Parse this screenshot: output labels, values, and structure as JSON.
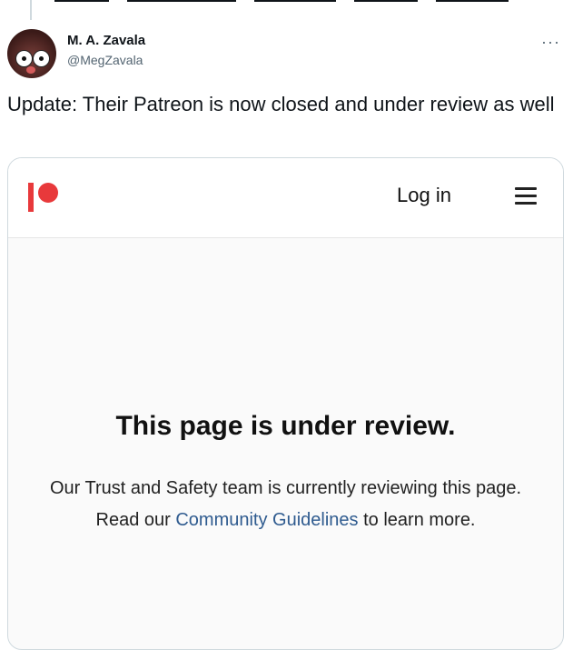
{
  "tweet": {
    "author_name": "M. A. Zavala",
    "author_handle": "@MegZavala",
    "more_label": "···",
    "text": "Update: Their Patreon is now closed and under review as well"
  },
  "card": {
    "logo_icon": "patreon-logo-icon",
    "login_label": "Log in",
    "menu_icon": "hamburger-menu-icon",
    "heading": "This page is under review.",
    "body_line1": "Our Trust and Safety team is currently reviewing this page.",
    "body_line2_prefix": "Read our ",
    "body_link": "Community Guidelines",
    "body_line2_suffix": " to learn more."
  },
  "colors": {
    "patreon_red": "#e8393b",
    "link_blue": "#2f5b8f",
    "handle_gray": "#536471"
  }
}
